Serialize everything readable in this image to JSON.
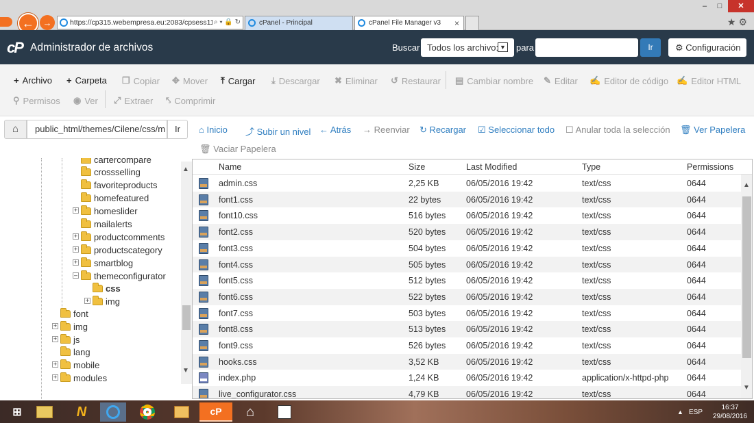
{
  "browser": {
    "address_url": "https://cp315.webempresa.eu:2083/cpsess115",
    "address_icons": "⌕ ▾ 🔒 ↻",
    "tabs": [
      {
        "label": "cPanel - Principal"
      },
      {
        "label": "cPanel File Manager v3"
      }
    ],
    "tab_close": "×",
    "window_min": "–",
    "window_max": "□",
    "window_close": "✕",
    "star_gear": "★⚙"
  },
  "header": {
    "logo": "cP",
    "title": "Administrador de archivos",
    "search_label": "Buscar",
    "search_scope": "Todos los archivo:",
    "para_label": "para",
    "search_placeholder": "",
    "go_label": "Ir",
    "settings_label": "⚙ Configuración"
  },
  "toolbar": {
    "row1": [
      {
        "icon": "+",
        "label": "Archivo",
        "enabled": true
      },
      {
        "icon": "+",
        "label": "Carpeta",
        "enabled": true
      },
      {
        "icon": "❐",
        "label": "Copiar",
        "enabled": false
      },
      {
        "icon": "✥",
        "label": "Mover",
        "enabled": false
      },
      {
        "icon": "⤒",
        "label": "Cargar",
        "enabled": true
      },
      {
        "icon": "⤓",
        "label": "Descargar",
        "enabled": false
      },
      {
        "icon": "✖",
        "label": "Eliminar",
        "enabled": false
      },
      {
        "icon": "↺",
        "label": "Restaurar",
        "enabled": false
      },
      {
        "icon": "▤",
        "label": "Cambiar nombre",
        "enabled": false
      },
      {
        "icon": "✎",
        "label": "Editar",
        "enabled": false
      },
      {
        "icon": "✍",
        "label": "Editor de código",
        "enabled": false
      },
      {
        "icon": "✍",
        "label": "Editor HTML",
        "enabled": false
      }
    ],
    "row2": [
      {
        "icon": "⚲",
        "label": "Permisos",
        "enabled": false
      },
      {
        "icon": "◉",
        "label": "Ver",
        "enabled": false
      },
      {
        "icon": "⤢",
        "label": "Extraer",
        "enabled": false
      },
      {
        "icon": "⤣",
        "label": "Comprimir",
        "enabled": false
      }
    ]
  },
  "pathbar": {
    "home_icon": "⌂",
    "path": "public_html/themes/Cilene/css/m",
    "go_label": "Ir"
  },
  "actions": {
    "inicio": "Inicio",
    "subir": "Subir un nivel",
    "atras": "Atrás",
    "reenviar": "Reenviar",
    "recargar": "Recargar",
    "seleccionar": "Seleccionar todo",
    "anular": "Anular toda la selección",
    "ver_papelera": "Ver Papelera",
    "vaciar_papelera": "Vaciar Papelera",
    "icons": {
      "inicio": "⌂",
      "subir": "⤴",
      "atras": "←",
      "reenviar": "→",
      "recargar": "↻",
      "seleccionar": "☑",
      "anular": "☐",
      "ver_papelera": "🗑",
      "vaciar_papelera": "🗑"
    }
  },
  "tree": {
    "items": [
      {
        "label": "cartercompare",
        "expander": ""
      },
      {
        "label": "crossselling",
        "expander": ""
      },
      {
        "label": "favoriteproducts",
        "expander": ""
      },
      {
        "label": "homefeatured",
        "expander": ""
      },
      {
        "label": "homeslider",
        "expander": "+"
      },
      {
        "label": "mailalerts",
        "expander": ""
      },
      {
        "label": "productcomments",
        "expander": "+"
      },
      {
        "label": "productscategory",
        "expander": "+"
      },
      {
        "label": "smartblog",
        "expander": "+"
      },
      {
        "label": "themeconfigurator",
        "expander": "–"
      },
      {
        "label": "css",
        "expander": ""
      },
      {
        "label": "img",
        "expander": "+"
      },
      {
        "label": "font",
        "expander": ""
      },
      {
        "label": "img",
        "expander": "+"
      },
      {
        "label": "js",
        "expander": "+"
      },
      {
        "label": "lang",
        "expander": ""
      },
      {
        "label": "mobile",
        "expander": "+"
      },
      {
        "label": "modules",
        "expander": "+"
      }
    ],
    "scroll_up": "▲",
    "scroll_down": "▼"
  },
  "table": {
    "columns": [
      "Name",
      "Size",
      "Last Modified",
      "Type",
      "Permissions"
    ],
    "rows": [
      {
        "name": "admin.css",
        "size": "2,25 KB",
        "modified": "06/05/2016 19:42",
        "type": "text/css",
        "perms": "0644",
        "icon": "css-file-icon"
      },
      {
        "name": "font1.css",
        "size": "22 bytes",
        "modified": "06/05/2016 19:42",
        "type": "text/css",
        "perms": "0644",
        "icon": "css-file-icon"
      },
      {
        "name": "font10.css",
        "size": "516 bytes",
        "modified": "06/05/2016 19:42",
        "type": "text/css",
        "perms": "0644",
        "icon": "css-file-icon"
      },
      {
        "name": "font2.css",
        "size": "520 bytes",
        "modified": "06/05/2016 19:42",
        "type": "text/css",
        "perms": "0644",
        "icon": "css-file-icon"
      },
      {
        "name": "font3.css",
        "size": "504 bytes",
        "modified": "06/05/2016 19:42",
        "type": "text/css",
        "perms": "0644",
        "icon": "css-file-icon"
      },
      {
        "name": "font4.css",
        "size": "505 bytes",
        "modified": "06/05/2016 19:42",
        "type": "text/css",
        "perms": "0644",
        "icon": "css-file-icon"
      },
      {
        "name": "font5.css",
        "size": "512 bytes",
        "modified": "06/05/2016 19:42",
        "type": "text/css",
        "perms": "0644",
        "icon": "css-file-icon"
      },
      {
        "name": "font6.css",
        "size": "522 bytes",
        "modified": "06/05/2016 19:42",
        "type": "text/css",
        "perms": "0644",
        "icon": "css-file-icon"
      },
      {
        "name": "font7.css",
        "size": "503 bytes",
        "modified": "06/05/2016 19:42",
        "type": "text/css",
        "perms": "0644",
        "icon": "css-file-icon"
      },
      {
        "name": "font8.css",
        "size": "513 bytes",
        "modified": "06/05/2016 19:42",
        "type": "text/css",
        "perms": "0644",
        "icon": "css-file-icon"
      },
      {
        "name": "font9.css",
        "size": "526 bytes",
        "modified": "06/05/2016 19:42",
        "type": "text/css",
        "perms": "0644",
        "icon": "css-file-icon"
      },
      {
        "name": "hooks.css",
        "size": "3,52 KB",
        "modified": "06/05/2016 19:42",
        "type": "text/css",
        "perms": "0644",
        "icon": "css-file-icon"
      },
      {
        "name": "index.php",
        "size": "1,24 KB",
        "modified": "06/05/2016 19:42",
        "type": "application/x-httpd-php",
        "perms": "0644",
        "icon": "php-file-icon"
      },
      {
        "name": "live_configurator.css",
        "size": "4,79 KB",
        "modified": "06/05/2016 19:42",
        "type": "text/css",
        "perms": "0644",
        "icon": "css-file-icon"
      }
    ],
    "scroll_up": "▲",
    "scroll_down": "▼"
  },
  "taskbar": {
    "start": "⊞",
    "cpanel_label": "cP",
    "tray_up": "▲",
    "language": "ESP",
    "time": "16:37",
    "date": "29/08/2016"
  },
  "colors": {
    "header_bg": "#293a4a",
    "accent_blue": "#337ab7",
    "link_blue": "#2f7ec0",
    "cpanel_orange": "#f37021"
  }
}
